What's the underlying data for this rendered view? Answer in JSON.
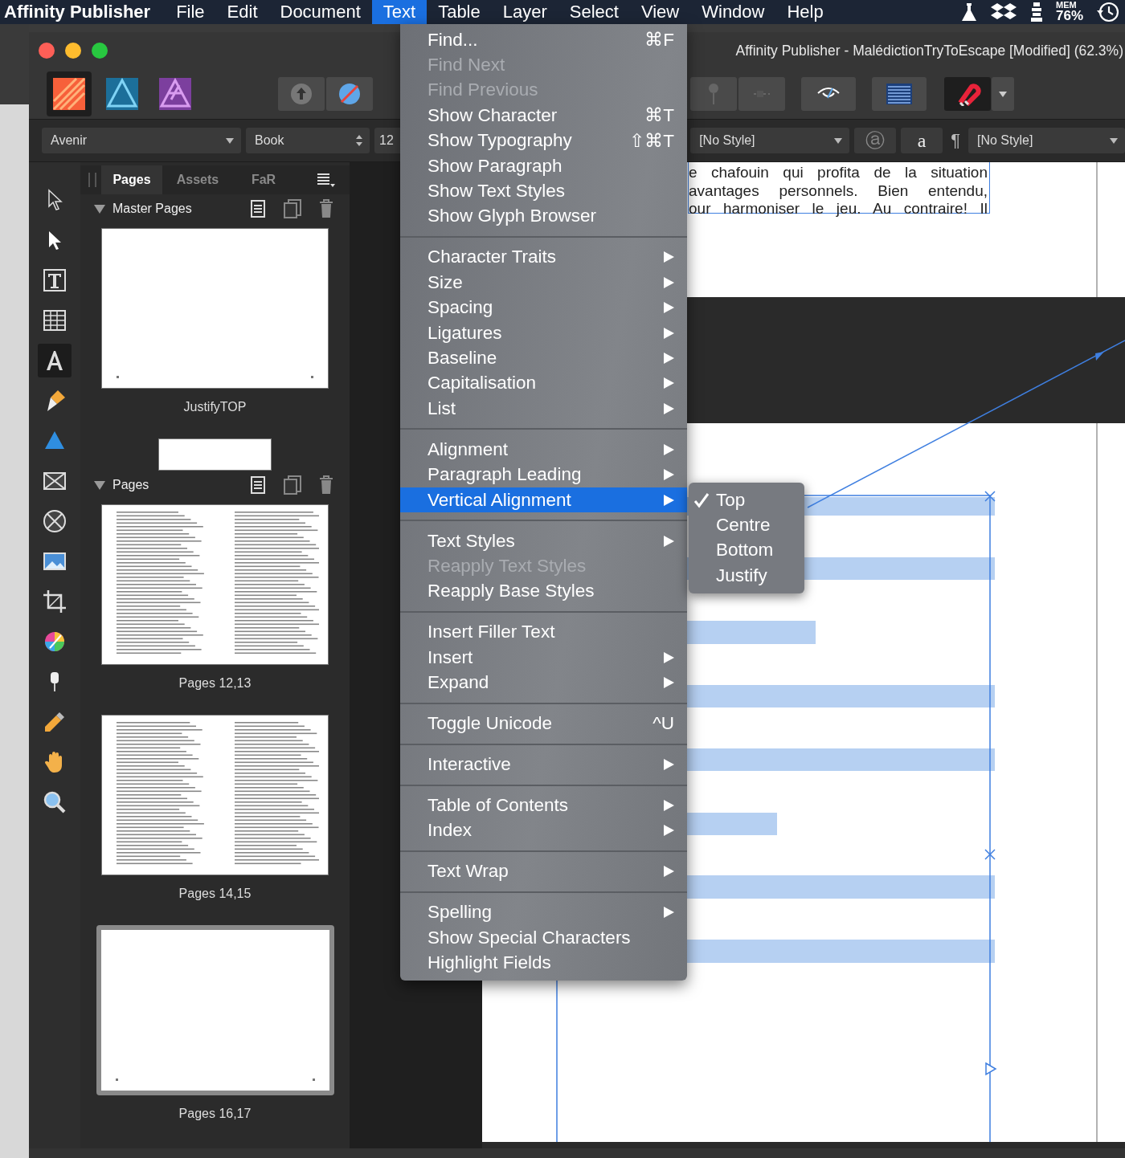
{
  "menubar": {
    "app_name": "Affinity Publisher",
    "items": [
      {
        "label": "File",
        "selected": false
      },
      {
        "label": "Edit",
        "selected": false
      },
      {
        "label": "Document",
        "selected": false
      },
      {
        "label": "Text",
        "selected": true
      },
      {
        "label": "Table",
        "selected": false
      },
      {
        "label": "Layer",
        "selected": false
      },
      {
        "label": "Select",
        "selected": false
      },
      {
        "label": "View",
        "selected": false
      },
      {
        "label": "Window",
        "selected": false
      },
      {
        "label": "Help",
        "selected": false
      }
    ],
    "memory": {
      "label": "MEM",
      "value": "76%"
    }
  },
  "window": {
    "title": "Affinity Publisher - MalédictionTryToEscape [Modified] (62.3%)"
  },
  "personas": [
    {
      "kind": "publisher",
      "selected": true
    },
    {
      "kind": "designer",
      "selected": false
    },
    {
      "kind": "photo",
      "selected": false
    }
  ],
  "context_bar": {
    "font": "Avenir",
    "weight": "Book",
    "size": "12",
    "paragraph_style": "[No Style]",
    "circle_glyph": "ⓐ",
    "char_glyph": "a",
    "pilcrow": "¶",
    "character_style": "[No Style]"
  },
  "tools": [
    {
      "kind": "move",
      "selected": false
    },
    {
      "kind": "node",
      "selected": false
    },
    {
      "kind": "frame-text",
      "selected": false
    },
    {
      "kind": "table",
      "selected": false
    },
    {
      "kind": "artistic-text",
      "selected": true
    },
    {
      "kind": "pen",
      "selected": false
    },
    {
      "kind": "shape",
      "selected": false
    },
    {
      "kind": "picture-frame",
      "selected": false
    },
    {
      "kind": "ellipse-frame",
      "selected": false
    },
    {
      "kind": "place-image",
      "selected": false
    },
    {
      "kind": "crop",
      "selected": false
    },
    {
      "kind": "colour-wheel",
      "selected": false
    },
    {
      "kind": "fill",
      "selected": false
    },
    {
      "kind": "eyedropper",
      "selected": false
    },
    {
      "kind": "hand",
      "selected": false
    },
    {
      "kind": "zoom",
      "selected": false
    }
  ],
  "panel": {
    "tabs": [
      {
        "label": "Pages",
        "selected": true
      },
      {
        "label": "Assets",
        "selected": false
      },
      {
        "label": "FaR",
        "selected": false
      }
    ],
    "master_pages": {
      "title": "Master Pages",
      "expanded": true,
      "items": [
        {
          "label": "JustifyTOP",
          "kind": "blank"
        },
        {
          "kind": "empty"
        }
      ]
    },
    "pages": {
      "title": "Pages",
      "expanded": true,
      "items": [
        {
          "label": "Pages 12,13",
          "kind": "text",
          "selected": false
        },
        {
          "label": "Pages 14,15",
          "kind": "text",
          "selected": false
        },
        {
          "label": "Pages 16,17",
          "kind": "blank",
          "selected": true
        }
      ]
    }
  },
  "document": {
    "text_lines": [
      "e chafouin qui profita de la situation",
      "avantages personnels. Bien entendu,",
      "our harmoniser le jeu. Au contraire! Il"
    ]
  },
  "menu": {
    "items": [
      {
        "kind": "item",
        "label": "Find...",
        "shortcut": "⌘F",
        "submenu": false,
        "disabled": false,
        "selected": false
      },
      {
        "kind": "item",
        "label": "Find Next",
        "submenu": false,
        "disabled": true,
        "selected": false
      },
      {
        "kind": "item",
        "label": "Find Previous",
        "submenu": false,
        "disabled": true,
        "selected": false
      },
      {
        "kind": "item",
        "label": "Show Character",
        "shortcut": "⌘T",
        "submenu": false,
        "disabled": false,
        "selected": false
      },
      {
        "kind": "item",
        "label": "Show Typography",
        "shortcut": "⇧⌘T",
        "submenu": false,
        "disabled": false,
        "selected": false
      },
      {
        "kind": "item",
        "label": "Show Paragraph",
        "submenu": false,
        "disabled": false,
        "selected": false
      },
      {
        "kind": "item",
        "label": "Show Text Styles",
        "submenu": false,
        "disabled": false,
        "selected": false
      },
      {
        "kind": "item",
        "label": "Show Glyph Browser",
        "submenu": false,
        "disabled": false,
        "selected": false
      },
      {
        "kind": "separator"
      },
      {
        "kind": "item",
        "label": "Character Traits",
        "submenu": true,
        "disabled": false,
        "selected": false
      },
      {
        "kind": "item",
        "label": "Size",
        "submenu": true,
        "disabled": false,
        "selected": false
      },
      {
        "kind": "item",
        "label": "Spacing",
        "submenu": true,
        "disabled": false,
        "selected": false
      },
      {
        "kind": "item",
        "label": "Ligatures",
        "submenu": true,
        "disabled": false,
        "selected": false
      },
      {
        "kind": "item",
        "label": "Baseline",
        "submenu": true,
        "disabled": false,
        "selected": false
      },
      {
        "kind": "item",
        "label": "Capitalisation",
        "submenu": true,
        "disabled": false,
        "selected": false
      },
      {
        "kind": "item",
        "label": "List",
        "submenu": true,
        "disabled": false,
        "selected": false
      },
      {
        "kind": "separator"
      },
      {
        "kind": "item",
        "label": "Alignment",
        "submenu": true,
        "disabled": false,
        "selected": false
      },
      {
        "kind": "item",
        "label": "Paragraph Leading",
        "submenu": true,
        "disabled": false,
        "selected": false
      },
      {
        "kind": "item",
        "label": "Vertical Alignment",
        "submenu": true,
        "disabled": false,
        "selected": true
      },
      {
        "kind": "separator"
      },
      {
        "kind": "item",
        "label": "Text Styles",
        "submenu": true,
        "disabled": false,
        "selected": false
      },
      {
        "kind": "item",
        "label": "Reapply Text Styles",
        "submenu": false,
        "disabled": true,
        "selected": false
      },
      {
        "kind": "item",
        "label": "Reapply Base Styles",
        "submenu": false,
        "disabled": false,
        "selected": false
      },
      {
        "kind": "separator"
      },
      {
        "kind": "item",
        "label": "Insert Filler Text",
        "submenu": false,
        "disabled": false,
        "selected": false
      },
      {
        "kind": "item",
        "label": "Insert",
        "submenu": true,
        "disabled": false,
        "selected": false
      },
      {
        "kind": "item",
        "label": "Expand",
        "submenu": true,
        "disabled": false,
        "selected": false
      },
      {
        "kind": "separator"
      },
      {
        "kind": "item",
        "label": "Toggle Unicode",
        "shortcut": "^U",
        "submenu": false,
        "disabled": false,
        "selected": false
      },
      {
        "kind": "separator"
      },
      {
        "kind": "item",
        "label": "Interactive",
        "submenu": true,
        "disabled": false,
        "selected": false
      },
      {
        "kind": "separator"
      },
      {
        "kind": "item",
        "label": "Table of Contents",
        "submenu": true,
        "disabled": false,
        "selected": false
      },
      {
        "kind": "item",
        "label": "Index",
        "submenu": true,
        "disabled": false,
        "selected": false
      },
      {
        "kind": "separator"
      },
      {
        "kind": "item",
        "label": "Text Wrap",
        "submenu": true,
        "disabled": false,
        "selected": false
      },
      {
        "kind": "separator"
      },
      {
        "kind": "item",
        "label": "Spelling",
        "submenu": true,
        "disabled": false,
        "selected": false
      },
      {
        "kind": "item",
        "label": "Show Special Characters",
        "submenu": false,
        "disabled": false,
        "selected": false
      },
      {
        "kind": "item",
        "label": "Highlight Fields",
        "submenu": false,
        "disabled": false,
        "selected": false
      }
    ]
  },
  "submenu": {
    "items": [
      {
        "label": "Top",
        "checked": true
      },
      {
        "label": "Centre",
        "checked": false
      },
      {
        "label": "Bottom",
        "checked": false
      },
      {
        "label": "Justify",
        "checked": false
      }
    ]
  }
}
